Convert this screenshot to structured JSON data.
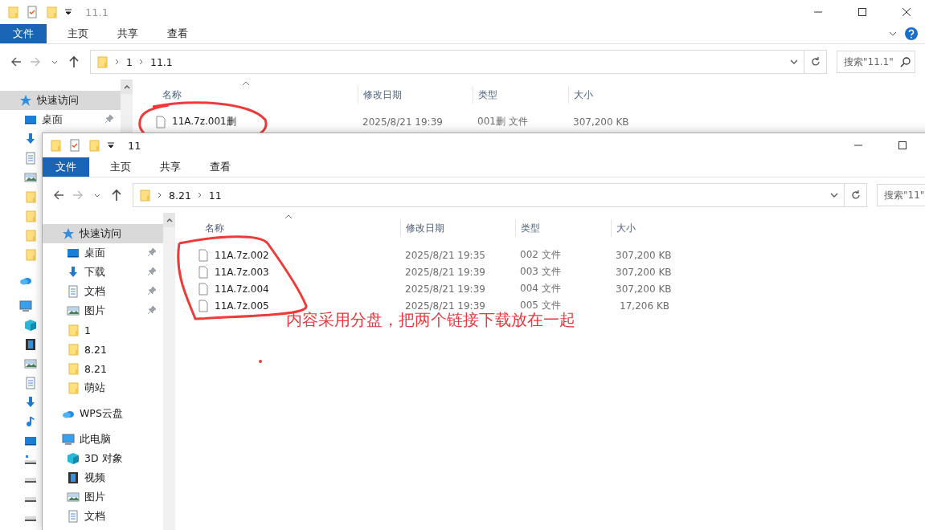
{
  "back_window": {
    "title": "11.1",
    "active": false,
    "ribbon_tabs": [
      {
        "label": "文件",
        "selected": true
      },
      {
        "label": "主页",
        "selected": false
      },
      {
        "label": "共享",
        "selected": false
      },
      {
        "label": "查看",
        "selected": false
      }
    ],
    "path": [
      "1",
      "11.1"
    ],
    "search": {
      "placeholder": "搜索\"11.1\""
    },
    "sidebar": [
      {
        "label": "快速访问",
        "kind": "star",
        "selected": true,
        "children": [
          {
            "label": "桌面",
            "kind": "desktop",
            "pinned": true
          },
          {
            "kind": "download"
          },
          {
            "kind": "document"
          },
          {
            "kind": "picture"
          },
          {
            "kind": "folder"
          },
          {
            "kind": "folder"
          },
          {
            "kind": "folder"
          },
          {
            "kind": "folder"
          }
        ]
      },
      {
        "kind": "cloud"
      },
      {
        "kind": "computer",
        "children": [
          {
            "kind": "cube"
          },
          {
            "kind": "film"
          },
          {
            "kind": "picture"
          },
          {
            "kind": "document"
          },
          {
            "kind": "download"
          },
          {
            "kind": "music"
          },
          {
            "kind": "desktop"
          },
          {
            "kind": "netdrive"
          },
          {
            "kind": "drive"
          },
          {
            "kind": "drive"
          },
          {
            "kind": "drive"
          }
        ]
      }
    ],
    "columns": [
      "名称",
      "修改日期",
      "类型",
      "大小"
    ],
    "rows": [
      {
        "name": "11A.7z.001删",
        "date": "2025/8/21 19:39",
        "type": "001删 文件",
        "size": "307,200 KB"
      }
    ]
  },
  "front_window": {
    "title": "11",
    "active": true,
    "ribbon_tabs": [
      {
        "label": "文件",
        "selected": true
      },
      {
        "label": "主页",
        "selected": false
      },
      {
        "label": "共享",
        "selected": false
      },
      {
        "label": "查看",
        "selected": false
      }
    ],
    "path": [
      "8.21",
      "11"
    ],
    "search": {
      "placeholder": "搜索\"11\""
    },
    "sidebar": [
      {
        "label": "快速访问",
        "kind": "star",
        "selected": true,
        "children": [
          {
            "label": "桌面",
            "kind": "desktop",
            "pinned": true
          },
          {
            "label": "下载",
            "kind": "download",
            "pinned": true
          },
          {
            "label": "文档",
            "kind": "document",
            "pinned": true
          },
          {
            "label": "图片",
            "kind": "picture",
            "pinned": true
          },
          {
            "label": "1",
            "kind": "folder",
            "pinned": false
          },
          {
            "label": "8.21",
            "kind": "folder",
            "pinned": false
          },
          {
            "label": "8.21",
            "kind": "folder",
            "pinned": false
          },
          {
            "label": "萌站",
            "kind": "folder",
            "pinned": false
          }
        ]
      },
      {
        "label": "WPS云盘",
        "kind": "cloud",
        "selected": false
      },
      {
        "label": "此电脑",
        "kind": "computer",
        "selected": false,
        "children": [
          {
            "label": "3D 对象",
            "kind": "cube"
          },
          {
            "label": "视频",
            "kind": "film"
          },
          {
            "label": "图片",
            "kind": "picture"
          },
          {
            "label": "文档",
            "kind": "document"
          }
        ]
      }
    ],
    "columns": [
      "名称",
      "修改日期",
      "类型",
      "大小"
    ],
    "rows": [
      {
        "name": "11A.7z.002",
        "date": "2025/8/21 19:35",
        "type": "002 文件",
        "size": "307,200 KB"
      },
      {
        "name": "11A.7z.003",
        "date": "2025/8/21 19:39",
        "type": "003 文件",
        "size": "307,200 KB"
      },
      {
        "name": "11A.7z.004",
        "date": "2025/8/21 19:39",
        "type": "004 文件",
        "size": "307,200 KB"
      },
      {
        "name": "11A.7z.005",
        "date": "2025/8/21 19:39",
        "type": "005 文件",
        "size": "17,206 KB"
      }
    ],
    "note": "内容采用分盘，把两个链接下载放在一起"
  }
}
